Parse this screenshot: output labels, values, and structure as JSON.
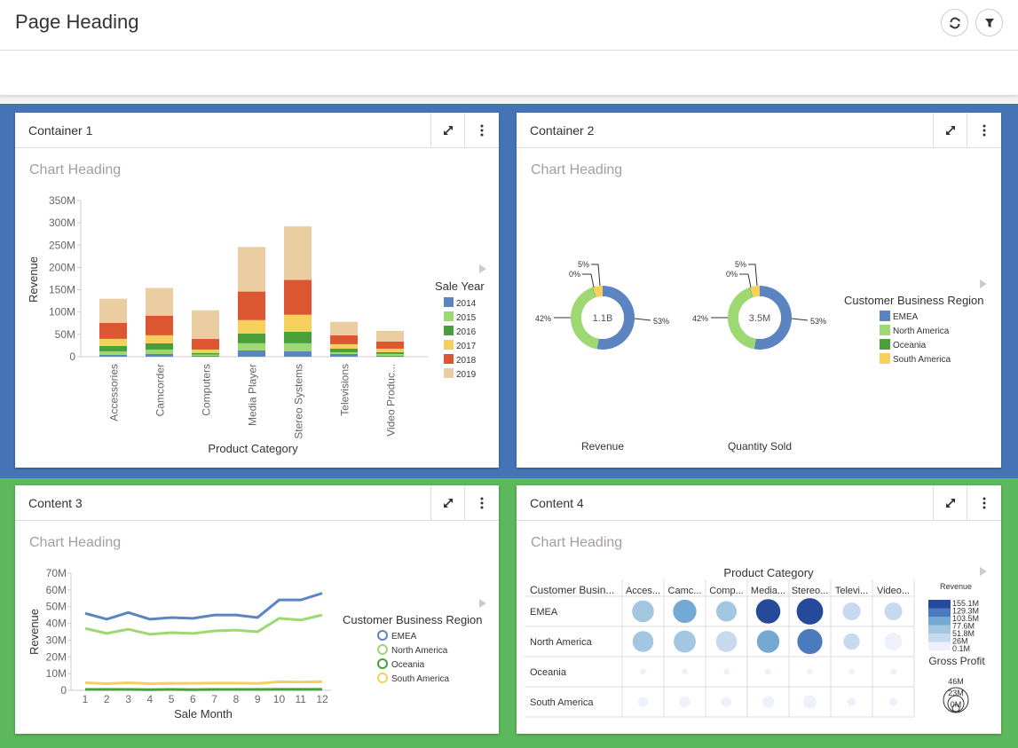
{
  "page": {
    "title": "Page Heading",
    "refresh_icon": "refresh-icon",
    "filter_icon": "filter-icon"
  },
  "colors": {
    "band_blue": "#4574b6",
    "band_green": "#5cb85c",
    "year_2014": "#5b84c1",
    "year_2015": "#9dd873",
    "year_2016": "#49a03b",
    "year_2017": "#f5d05a",
    "year_2018": "#dc5632",
    "year_2019": "#ebcda2",
    "emea": "#5b84c1",
    "north_america": "#9dd873",
    "oceania": "#49a03b",
    "south_america": "#f5d05a"
  },
  "cards": [
    {
      "title": "Container 1",
      "chart_heading": "Chart Heading",
      "maximize_icon": "maximize-icon",
      "menu_icon": "more-vertical-icon"
    },
    {
      "title": "Container 2",
      "chart_heading": "Chart Heading",
      "maximize_icon": "maximize-icon",
      "menu_icon": "more-vertical-icon"
    },
    {
      "title": "Content 3",
      "chart_heading": "Chart Heading",
      "maximize_icon": "maximize-icon",
      "menu_icon": "more-vertical-icon"
    },
    {
      "title": "Content 4",
      "chart_heading": "Chart Heading",
      "maximize_icon": "maximize-icon",
      "menu_icon": "more-vertical-icon"
    }
  ],
  "chart_data": [
    {
      "type": "bar",
      "stacked": true,
      "title": "Chart Heading",
      "xlabel": "Product Category",
      "ylabel": "Revenue",
      "ylim": [
        0,
        350
      ],
      "yticks": [
        "0",
        "50M",
        "100M",
        "150M",
        "200M",
        "250M",
        "300M",
        "350M"
      ],
      "ytick_values": [
        0,
        50,
        100,
        150,
        200,
        250,
        300,
        350
      ],
      "categories": [
        "Accessories",
        "Camcorder",
        "Computers",
        "Media Player",
        "Stereo Systems",
        "Televisions",
        "Video Produc..."
      ],
      "legend_title": "Sale Year",
      "legend_position": "right",
      "series": [
        {
          "name": "2014",
          "color": "#5b84c1",
          "values": [
            4,
            6,
            2,
            14,
            12,
            6,
            2
          ]
        },
        {
          "name": "2015",
          "color": "#9dd873",
          "values": [
            8,
            10,
            3,
            16,
            18,
            4,
            4
          ]
        },
        {
          "name": "2016",
          "color": "#49a03b",
          "values": [
            12,
            14,
            3,
            22,
            26,
            8,
            4
          ]
        },
        {
          "name": "2017",
          "color": "#f5d05a",
          "values": [
            16,
            18,
            8,
            30,
            38,
            10,
            8
          ]
        },
        {
          "name": "2018",
          "color": "#dc5632",
          "values": [
            36,
            44,
            24,
            64,
            78,
            20,
            16
          ]
        },
        {
          "name": "2019",
          "color": "#ebcda2",
          "values": [
            54,
            62,
            64,
            100,
            120,
            30,
            24
          ]
        }
      ]
    },
    {
      "type": "pie",
      "title": "Chart Heading",
      "legend_title": "Customer Business Region",
      "legend_position": "right",
      "legend": [
        {
          "name": "EMEA",
          "color": "#5b84c1"
        },
        {
          "name": "North America",
          "color": "#9dd873"
        },
        {
          "name": "Oceania",
          "color": "#49a03b"
        },
        {
          "name": "South America",
          "color": "#f5d05a"
        }
      ],
      "donuts": [
        {
          "label": "Revenue",
          "center": "1.1B",
          "slices": [
            {
              "name": "EMEA",
              "value": 53,
              "label": "53%"
            },
            {
              "name": "North America",
              "value": 42,
              "label": "42%"
            },
            {
              "name": "Oceania",
              "value": 0.3,
              "label": "0%"
            },
            {
              "name": "South America",
              "value": 5,
              "label": "5%"
            }
          ]
        },
        {
          "label": "Quantity Sold",
          "center": "3.5M",
          "slices": [
            {
              "name": "EMEA",
              "value": 53,
              "label": "53%"
            },
            {
              "name": "North America",
              "value": 42,
              "label": "42%"
            },
            {
              "name": "Oceania",
              "value": 0.3,
              "label": "0%"
            },
            {
              "name": "South America",
              "value": 5,
              "label": "5%"
            }
          ]
        }
      ]
    },
    {
      "type": "line",
      "title": "Chart Heading",
      "xlabel": "Sale Month",
      "ylabel": "Revenue",
      "ylim": [
        0,
        70
      ],
      "yticks": [
        "0",
        "10M",
        "20M",
        "30M",
        "40M",
        "50M",
        "60M",
        "70M"
      ],
      "ytick_values": [
        0,
        10,
        20,
        30,
        40,
        50,
        60,
        70
      ],
      "x": [
        1,
        2,
        3,
        4,
        5,
        6,
        7,
        8,
        9,
        10,
        11,
        12
      ],
      "legend_title": "Customer Business Region",
      "legend_position": "right",
      "series": [
        {
          "name": "EMEA",
          "color": "#5b84c1",
          "values": [
            46,
            42.5,
            46.5,
            42.5,
            43.5,
            43,
            45,
            45,
            43.5,
            54,
            54,
            58
          ]
        },
        {
          "name": "North America",
          "color": "#9dd873",
          "values": [
            37,
            34,
            36.5,
            33.5,
            34.5,
            34,
            35.5,
            36,
            35,
            43,
            42,
            45
          ]
        },
        {
          "name": "Oceania",
          "color": "#49a03b",
          "values": [
            0.5,
            0.5,
            0.5,
            0.4,
            0.5,
            0.4,
            0.5,
            0.5,
            0.5,
            0.6,
            0.6,
            0.6
          ]
        },
        {
          "name": "South America",
          "color": "#f5d05a",
          "values": [
            4.5,
            4,
            4.5,
            4,
            4.2,
            4.2,
            4.3,
            4.3,
            4.1,
            5.1,
            5,
            5.2
          ]
        }
      ]
    },
    {
      "type": "heatmap",
      "title": "Chart Heading",
      "xlabel": "Product Category",
      "row_header": "Customer Busin...",
      "columns": [
        "Acces...",
        "Camc...",
        "Comp...",
        "Media...",
        "Stereo...",
        "Televi...",
        "Video..."
      ],
      "rows": [
        "EMEA",
        "North America",
        "Oceania",
        "South America"
      ],
      "revenue": [
        [
          70,
          95,
          62,
          148,
          155,
          38,
          42
        ],
        [
          62,
          70,
          40,
          88,
          125,
          34,
          12
        ],
        [
          1,
          1,
          1,
          1,
          1,
          1,
          1
        ],
        [
          5,
          6,
          4,
          8,
          10,
          3,
          3
        ]
      ],
      "gross_profit": [
        [
          27,
          31,
          24,
          34,
          40,
          18,
          18
        ],
        [
          25,
          28,
          25,
          29,
          36,
          15,
          18
        ],
        [
          2,
          2,
          2,
          2,
          2,
          2,
          2
        ],
        [
          6,
          7,
          6,
          8,
          10,
          4,
          4
        ]
      ],
      "color_legend_title": "Revenue",
      "color_legend_labels": [
        "155.1M",
        "129.3M",
        "103.5M",
        "77.6M",
        "51.8M",
        "26M",
        "0.1M"
      ],
      "color_scale": [
        "#264a9a",
        "#4a7bbf",
        "#74a9d4",
        "#a3c7e1",
        "#c6d9ee",
        "#eef1fc"
      ],
      "size_legend_title": "Gross Profit",
      "size_legend_labels": [
        "46M",
        "23M",
        "0M"
      ]
    }
  ]
}
